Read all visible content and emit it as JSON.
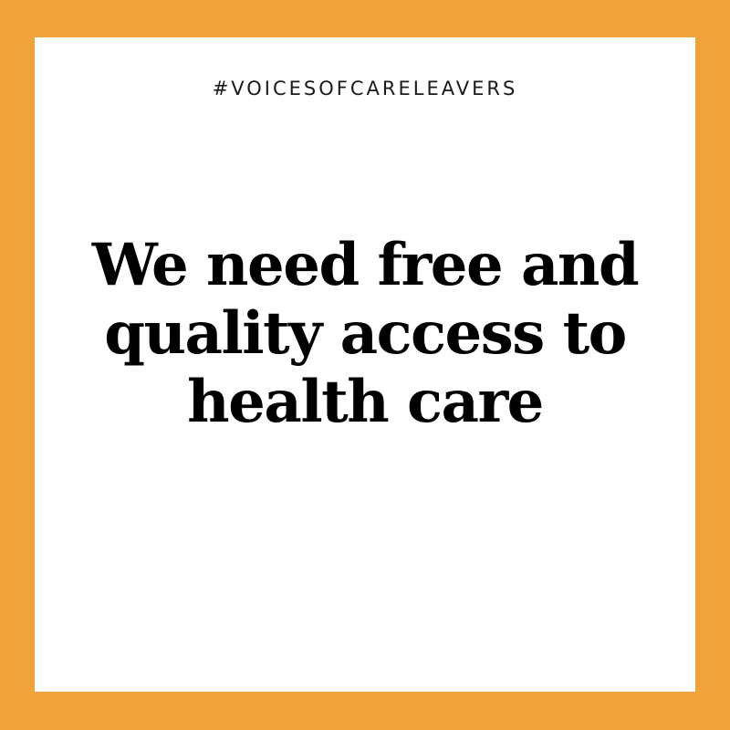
{
  "background_color": "#F2A23A",
  "panel_color": "#FFFFFF",
  "hashtag": "#VOICESOFCARELEAVERS",
  "headline": {
    "line1": "We need free and",
    "line2": "quality access to",
    "line3": "health care"
  }
}
